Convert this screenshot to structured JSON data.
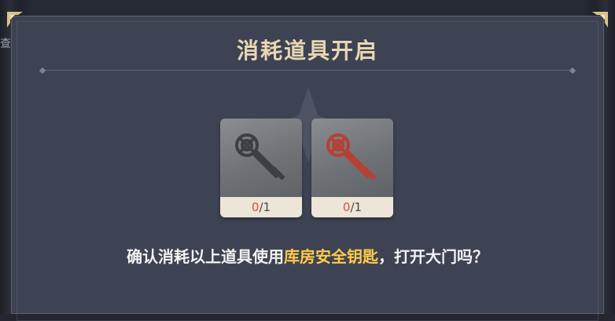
{
  "background": {
    "peek_text": "查"
  },
  "dialog": {
    "title": "消耗道具开启",
    "items": [
      {
        "icon": "dark-key-icon",
        "have": "0",
        "need": "/1",
        "key_color": "#3b3f46"
      },
      {
        "icon": "red-key-icon",
        "have": "0",
        "need": "/1",
        "key_color": "#b54036"
      }
    ],
    "question_prefix": "确认消耗以上道具使用",
    "question_item": "库房安全钥匙",
    "question_suffix": "，打开大门吗？"
  },
  "colors": {
    "panel": "#3d4353",
    "title": "#e8d7b2",
    "highlight": "#ffcb4a",
    "count_have": "#d0543a",
    "count_bg": "#ece5d8"
  }
}
